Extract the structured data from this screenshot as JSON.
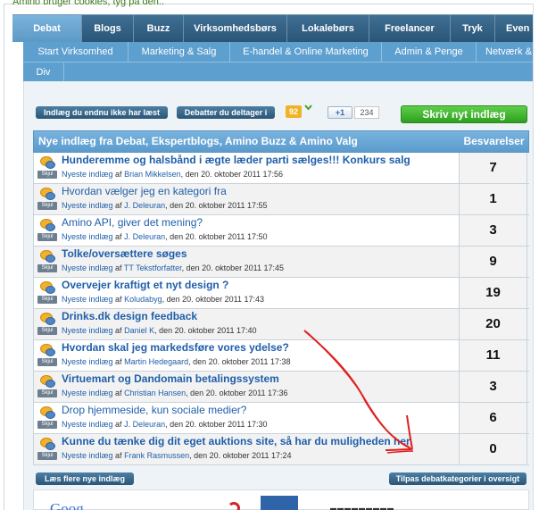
{
  "cookie_notice": "Amino bruger cookies, tyg på den..",
  "main_nav": [
    {
      "label": "Debat",
      "active": true
    },
    {
      "label": "Blogs"
    },
    {
      "label": "Buzz"
    },
    {
      "label": "Virksomhedsbørs"
    },
    {
      "label": "Lokalebørs"
    },
    {
      "label": "Freelancer"
    },
    {
      "label": "Tryk"
    },
    {
      "label": "Even"
    }
  ],
  "sub_nav_row1": [
    "Start Virksomhed",
    "Marketing & Salg",
    "E-handel & Online Marketing",
    "Admin & Penge",
    "Netværk &"
  ],
  "sub_nav_row2": [
    "Div"
  ],
  "toolbar": {
    "unread_button": "Indlæg du endnu ikke har læst",
    "participating_button": "Debatter du deltager i",
    "counter": "92",
    "gplus": "+1",
    "gplus_count": "234",
    "new_post_button": "Skriv nyt indlæg"
  },
  "table": {
    "header_title": "Nye indlæg fra Debat, Ekspertblogs, Amino Buzz & Amino Valg",
    "header_replies": "Besvarelser",
    "meta_prefix": "Nyeste indlæg",
    "meta_by": "af",
    "hide_label": "Skjul",
    "rows": [
      {
        "title": "Hunderemme og halsbånd i ægte læder parti sælges!!! Konkurs salg",
        "bold": true,
        "author": "Brian Mikkelsen",
        "date": ", den 20. oktober 2011 17:56",
        "replies": "7"
      },
      {
        "title": "Hvordan vælger jeg en kategori fra",
        "bold": false,
        "author": "J. Deleuran",
        "date": ", den 20. oktober 2011 17:55",
        "replies": "1"
      },
      {
        "title": "Amino API, giver det mening?",
        "bold": false,
        "author": "J. Deleuran",
        "date": ", den 20. oktober 2011 17:50",
        "replies": "3"
      },
      {
        "title": "Tolke/oversættere søges",
        "bold": true,
        "author": "TT Tekstforfatter",
        "date": ", den 20. oktober 2011 17:45",
        "replies": "9"
      },
      {
        "title": "Overvejer kraftigt et nyt design ?",
        "bold": true,
        "author": "Koludabyg",
        "date": ", den 20. oktober 2011 17:43",
        "replies": "19"
      },
      {
        "title": "Drinks.dk design feedback",
        "bold": true,
        "author": "Daniel K",
        "date": ", den 20. oktober 2011 17:40",
        "replies": "20"
      },
      {
        "title": "Hvordan skal jeg markedsføre vores ydelse?",
        "bold": true,
        "author": "Martin Hedegaard",
        "date": ", den 20. oktober 2011 17:38",
        "replies": "11"
      },
      {
        "title": "Virtuemart og Dandomain betalingssystem",
        "bold": true,
        "author": "Christian Hansen",
        "date": ", den 20. oktober 2011 17:36",
        "replies": "3"
      },
      {
        "title": "Drop hjemmeside, kun sociale medier?",
        "bold": false,
        "author": "J. Deleuran",
        "date": ", den 20. oktober 2011 17:30",
        "replies": "6"
      },
      {
        "title": "Kunne du tænke dig dit eget auktions site, så har du muligheden her.",
        "bold": true,
        "author": "Frank Rasmussen",
        "date": ", den 20. oktober 2011 17:24",
        "replies": "0"
      }
    ]
  },
  "footer": {
    "more_button": "Læs flere nye indlæg",
    "adjust_button": "Tilpas debatkategorier i oversigt"
  },
  "bottom_logo": "Goog",
  "icons": [
    "chat-bubble-icon",
    "chevron-down-icon",
    "gplus-icon"
  ],
  "colors": {
    "nav_dark": "#2a5577",
    "nav_active": "#5c98c5",
    "subnav": "#5d9fcf",
    "link": "#1f5faa",
    "green_button": "#2f9e1f",
    "annotation_red": "#e02020"
  }
}
